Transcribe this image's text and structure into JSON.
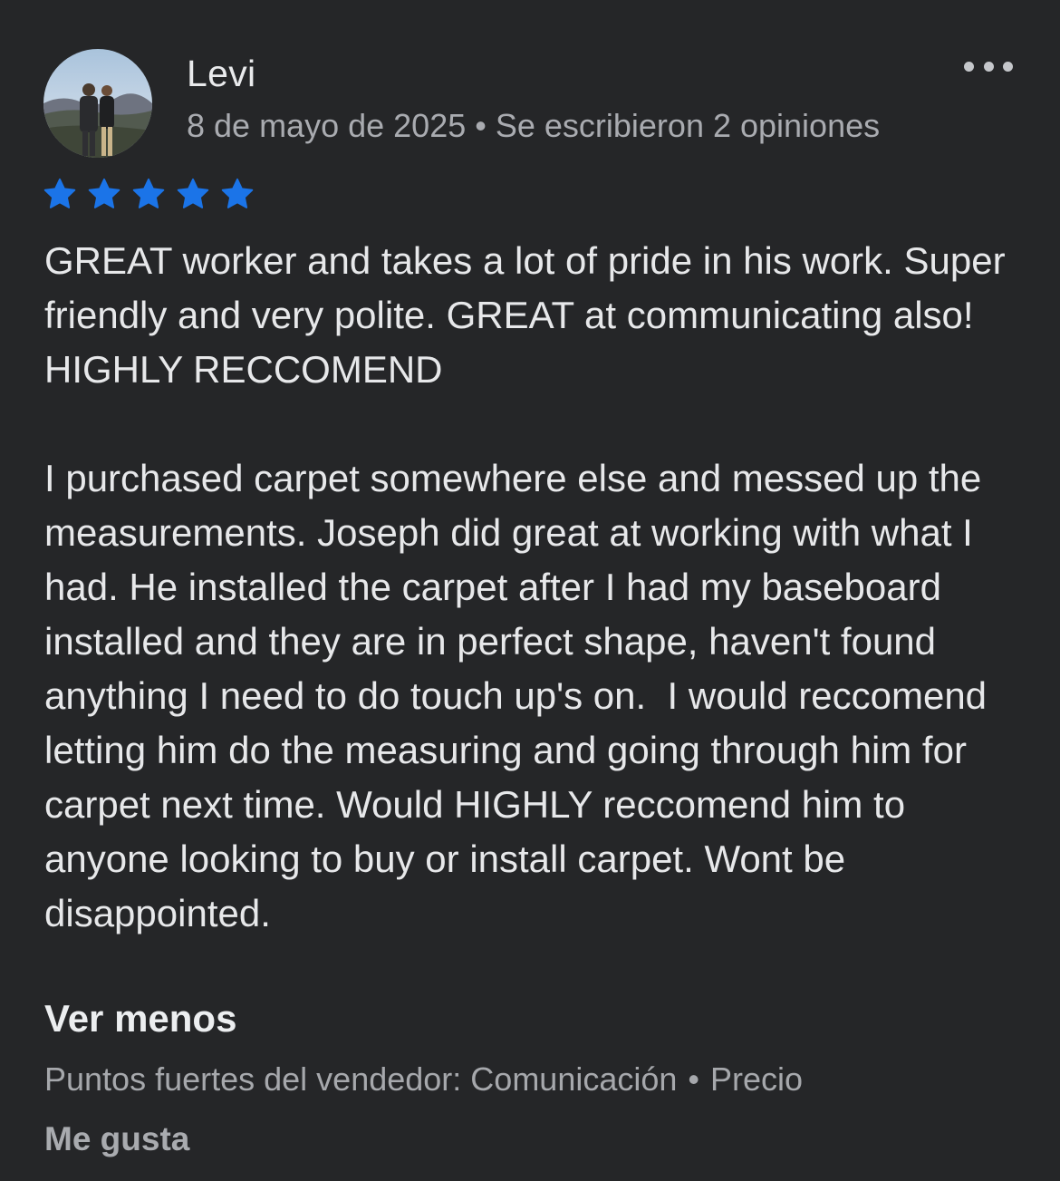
{
  "review": {
    "author": "Levi",
    "date": "8 de mayo de 2025",
    "separator": "•",
    "review_count": "Se escribieron 2 opiniones",
    "rating": 5,
    "star_color": "#1b74e8",
    "text": "GREAT worker and takes a lot of pride in his work. Super friendly and very polite. GREAT at communicating also! HIGHLY RECCOMEND\n\nI purchased carpet somewhere else and messed up the measurements. Joseph did great at working with what I had. He installed the carpet after I had my baseboard installed and they are in perfect shape, haven't found anything I need to do touch up's on.  I would reccomend letting him do the measuring and going through him for carpet next time. Would HIGHLY reccomend him to anyone looking to buy or install carpet. Wont be disappointed.",
    "see_less": "Ver menos",
    "strengths_label": "Puntos fuertes del vendedor: Comunicación",
    "strengths_extra": "Precio",
    "like": "Me gusta",
    "more_icon": "more-horizontal-icon"
  }
}
